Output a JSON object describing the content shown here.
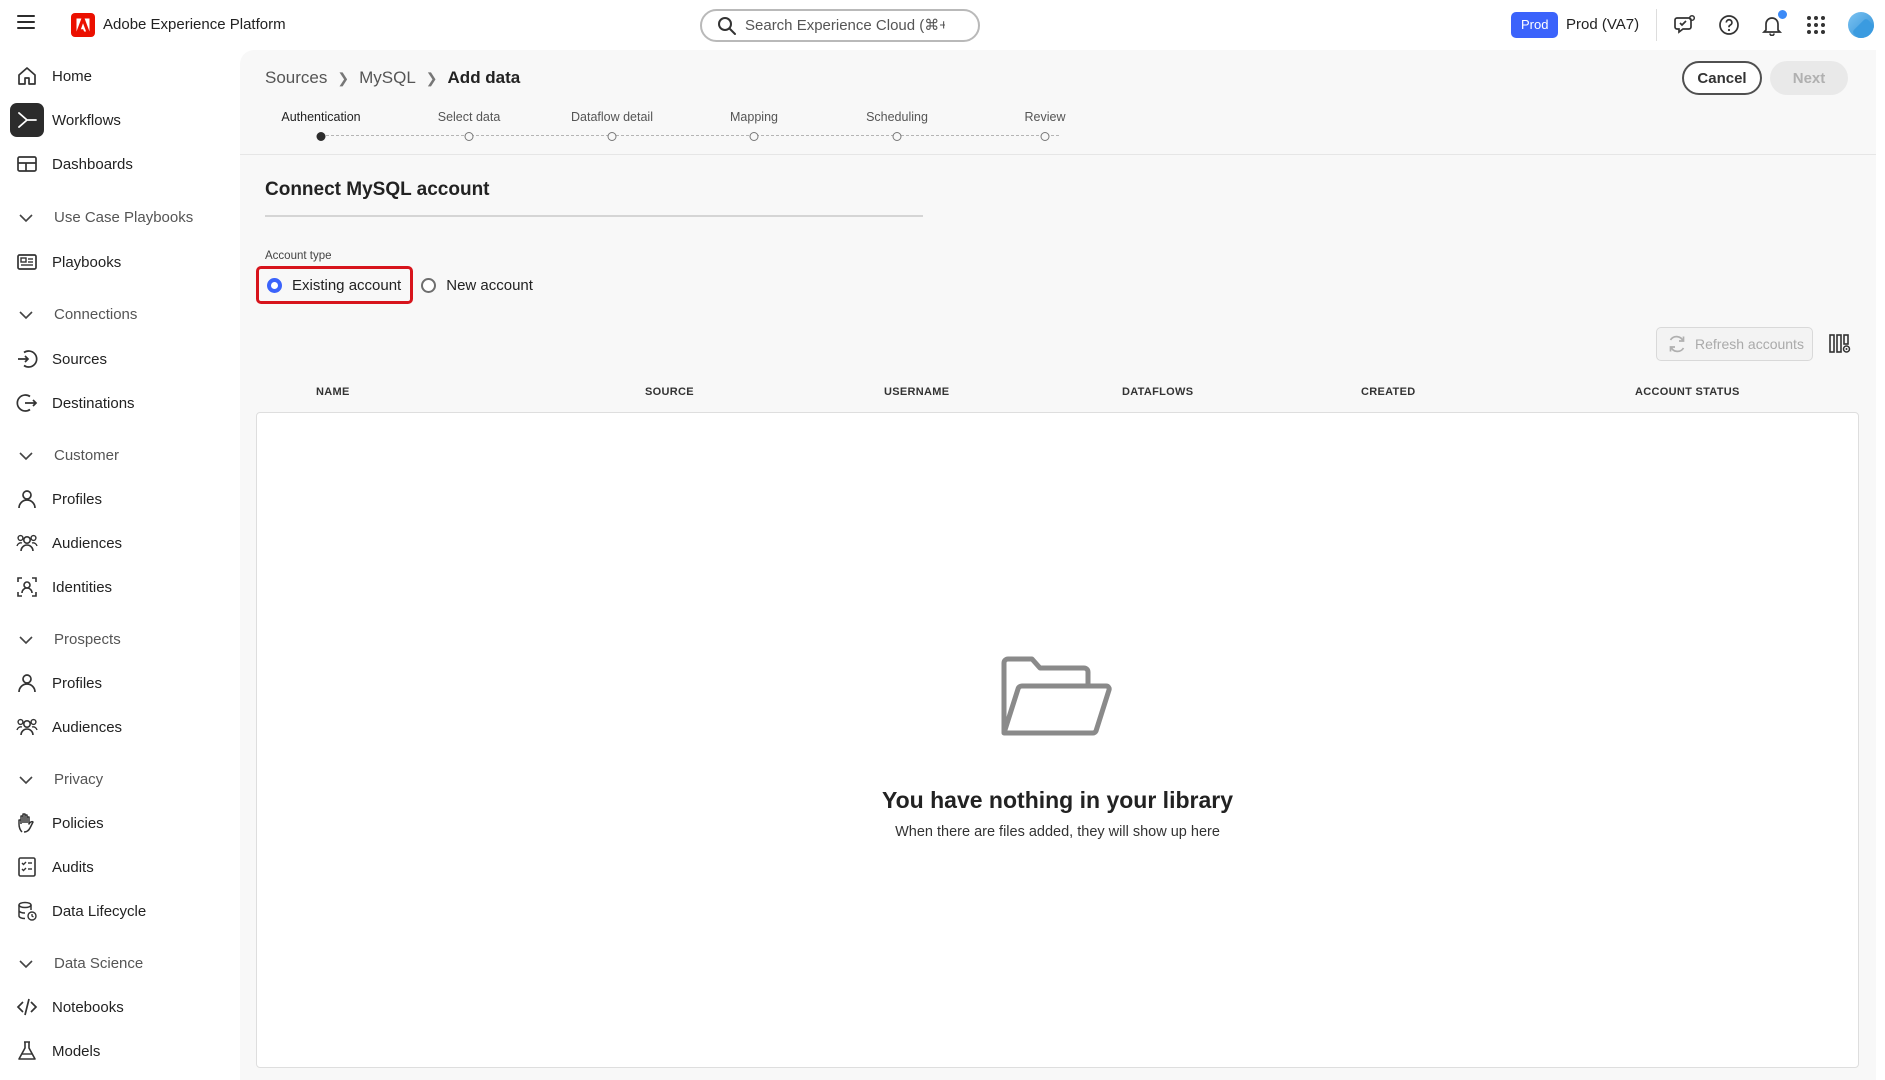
{
  "header": {
    "app_title": "Adobe Experience Platform",
    "search_placeholder": "Search Experience Cloud (⌘+/)",
    "env_badge": "Prod",
    "env_name": "Prod (VA7)",
    "icons": [
      "hamburger-menu-icon",
      "adobe-logo-icon",
      "search-icon",
      "feedback-icon",
      "help-icon",
      "notifications-icon",
      "apps-grid-icon",
      "avatar"
    ]
  },
  "sidebar": {
    "items": [
      {
        "label": "Home",
        "icon": "home-icon"
      },
      {
        "label": "Workflows",
        "icon": "workflows-icon",
        "active": true
      },
      {
        "label": "Dashboards",
        "icon": "dashboards-icon"
      },
      {
        "section": "Use Case Playbooks"
      },
      {
        "label": "Playbooks",
        "icon": "playbooks-icon"
      },
      {
        "section": "Connections"
      },
      {
        "label": "Sources",
        "icon": "sources-icon"
      },
      {
        "label": "Destinations",
        "icon": "destinations-icon"
      },
      {
        "section": "Customer"
      },
      {
        "label": "Profiles",
        "icon": "profile-icon"
      },
      {
        "label": "Audiences",
        "icon": "audiences-icon"
      },
      {
        "label": "Identities",
        "icon": "identities-icon"
      },
      {
        "section": "Prospects"
      },
      {
        "label": "Profiles",
        "icon": "profile-icon"
      },
      {
        "label": "Audiences",
        "icon": "audiences-icon"
      },
      {
        "section": "Privacy"
      },
      {
        "label": "Policies",
        "icon": "policies-icon"
      },
      {
        "label": "Audits",
        "icon": "audits-icon"
      },
      {
        "label": "Data Lifecycle",
        "icon": "data-lifecycle-icon"
      },
      {
        "section": "Data Science"
      },
      {
        "label": "Notebooks",
        "icon": "notebooks-icon"
      },
      {
        "label": "Models",
        "icon": "models-icon"
      }
    ]
  },
  "breadcrumb": {
    "items": [
      "Sources",
      "MySQL"
    ],
    "current": "Add data"
  },
  "actions": {
    "cancel": "Cancel",
    "next": "Next"
  },
  "steps": [
    {
      "label": "Authentication",
      "active": true
    },
    {
      "label": "Select data",
      "active": false
    },
    {
      "label": "Dataflow detail",
      "active": false
    },
    {
      "label": "Mapping",
      "active": false
    },
    {
      "label": "Scheduling",
      "active": false
    },
    {
      "label": "Review",
      "active": false
    }
  ],
  "form": {
    "title": "Connect MySQL account",
    "account_type_label": "Account type",
    "options": [
      {
        "label": "Existing account",
        "checked": true
      },
      {
        "label": "New account",
        "checked": false
      }
    ]
  },
  "table": {
    "refresh_label": "Refresh accounts",
    "columns": [
      "NAME",
      "SOURCE",
      "USERNAME",
      "DATAFLOWS",
      "CREATED",
      "ACCOUNT STATUS"
    ],
    "rows": [],
    "empty_title": "You have nothing in your library",
    "empty_subtitle": "When there are files added, they will show up here"
  },
  "colors": {
    "accent": "#3b63fb",
    "highlight": "#d7141c",
    "brand": "#eb1000"
  }
}
